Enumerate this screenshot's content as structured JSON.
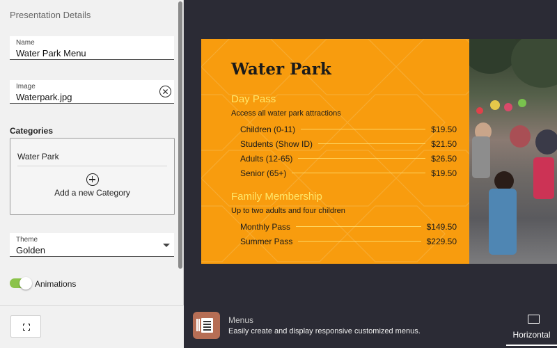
{
  "panel": {
    "title": "Presentation Details",
    "name_field": {
      "label": "Name",
      "value": "Water Park Menu"
    },
    "image_field": {
      "label": "Image",
      "value": "Waterpark.jpg",
      "clear_icon": "clear-circle-icon"
    },
    "categories": {
      "heading": "Categories",
      "items": [
        "Water Park"
      ],
      "add_label": "Add a new Category"
    },
    "theme_field": {
      "label": "Theme",
      "value": "Golden"
    },
    "animations": {
      "label": "Animations",
      "enabled": true
    }
  },
  "preview": {
    "title": "Water Park",
    "sections": [
      {
        "title": "Day Pass",
        "description": "Access all water park attractions",
        "items": [
          {
            "name": "Children (0-11)",
            "price": "$19.50"
          },
          {
            "name": "Students (Show ID)",
            "price": "$21.50"
          },
          {
            "name": "Adults (12-65)",
            "price": "$26.50"
          },
          {
            "name": "Senior (65+)",
            "price": "$19.50"
          }
        ]
      },
      {
        "title": "Family Membership",
        "description": "Up to two adults and four children",
        "items": [
          {
            "name": "Monthly Pass",
            "price": "$149.50"
          },
          {
            "name": "Summer Pass",
            "price": "$229.50"
          }
        ]
      }
    ]
  },
  "app_info": {
    "name": "Menus",
    "description": "Easily create and display responsive customized menus."
  },
  "orientation": {
    "label": "Horizontal"
  },
  "colors": {
    "preview_background": "#f89c0e",
    "section_title": "#ffe76a",
    "toggle_on": "#8bc34a",
    "app_icon": "#b66e55",
    "canvas_background": "#2b2b35"
  }
}
